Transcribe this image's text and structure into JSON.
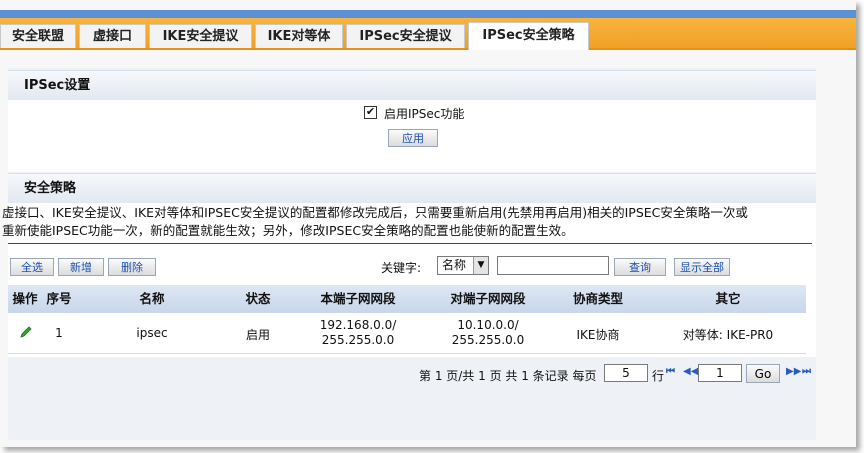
{
  "tabs": [
    {
      "label": "安全联盟",
      "active": false
    },
    {
      "label": "虚接口",
      "active": false
    },
    {
      "label": "IKE安全提议",
      "active": false
    },
    {
      "label": "IKE对等体",
      "active": false
    },
    {
      "label": "IPSec安全提议",
      "active": false
    },
    {
      "label": "IPSec安全策略",
      "active": true
    }
  ],
  "ipsec_settings": {
    "title": "IPSec设置",
    "enable_checked": true,
    "enable_label": "启用IPSec功能",
    "apply_label": "应用"
  },
  "policy": {
    "title": "安全策略",
    "description_line1": "虚接口、IKE安全提议、IKE对等体和IPSEC安全提议的配置都修改完成后，只需要重新启用(先禁用再启用)相关的IPSEC安全策略一次或",
    "description_line2": "重新使能IPSEC功能一次，新的配置就能生效；另外，修改IPSEC安全策略的配置也能使新的配置生效。",
    "buttons": {
      "select_all": "全选",
      "add": "新增",
      "delete": "删除",
      "search": "查询",
      "show_all": "显示全部"
    },
    "keyword_label": "关键字:",
    "keyword_field": "名称",
    "keyword_value": ""
  },
  "table": {
    "columns": [
      "操作",
      "序号",
      "名称",
      "状态",
      "本端子网网段",
      "对端子网网段",
      "协商类型",
      "其它"
    ],
    "rows": [
      {
        "seq": "1",
        "name": "ipsec",
        "status": "启用",
        "local_line1": "192.168.0.0/",
        "local_line2": "255.255.0.0",
        "remote_line1": "10.10.0.0/",
        "remote_line2": "255.255.0.0",
        "nego": "IKE协商",
        "other": "对等体: IKE-PR0"
      }
    ]
  },
  "pager": {
    "text_before": "第 1 页/共 1 页 共 1 条记录 每页",
    "per_page": "5",
    "text_after": "行",
    "page": "1",
    "go_label": "Go"
  },
  "colors": {
    "tab_bar": "#f0a027",
    "header_bg": "#c7d6eb",
    "accent": "#5b8fd6"
  }
}
